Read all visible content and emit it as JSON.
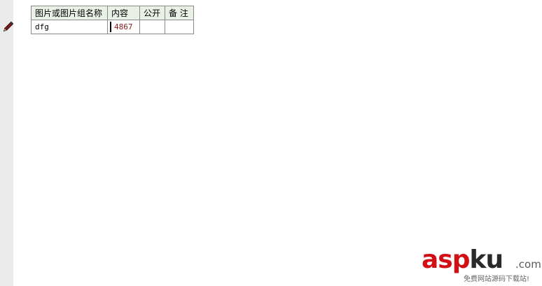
{
  "table": {
    "headers": [
      "图片或图片组名称",
      "内容",
      "公开",
      "备 注"
    ],
    "rows": [
      [
        "dfg",
        "4867",
        "",
        ""
      ]
    ]
  },
  "icons": {
    "row_editor": "pencil-icon"
  },
  "colors": {
    "gutter": "#ebebeb",
    "header_bg": "#e9f1e7",
    "border": "#8a8a8a",
    "value_text": "#8b1a1a",
    "watermark_red": "#d10f14"
  },
  "watermark": {
    "brand_red": "asp",
    "brand_dark": "ku",
    "domain_suffix": ".com",
    "subtitle": "免费网站源码下载站!"
  }
}
